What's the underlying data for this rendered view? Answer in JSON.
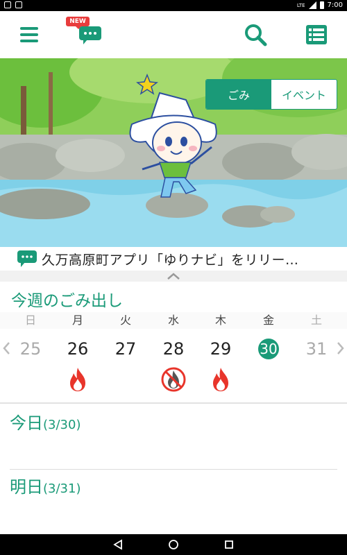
{
  "status_bar": {
    "time": "7:00",
    "network": "LTE"
  },
  "toolbar": {
    "new_badge": "NEW",
    "icons": [
      "menu-icon",
      "chat-bubble-icon",
      "search-icon",
      "list-icon"
    ]
  },
  "segment": {
    "garbage": "ごみ",
    "event": "イベント",
    "active": "garbage"
  },
  "news": {
    "text": "久万高原町アプリ「ゆりナビ」をリリー…"
  },
  "week": {
    "title": "今週のごみ出し",
    "days": [
      {
        "dow": "日",
        "num": "25",
        "muted": true,
        "garbage": ""
      },
      {
        "dow": "月",
        "num": "26",
        "muted": false,
        "garbage": "burnable"
      },
      {
        "dow": "火",
        "num": "27",
        "muted": false,
        "garbage": ""
      },
      {
        "dow": "水",
        "num": "28",
        "muted": false,
        "garbage": "non-burnable"
      },
      {
        "dow": "木",
        "num": "29",
        "muted": false,
        "garbage": "burnable"
      },
      {
        "dow": "金",
        "num": "30",
        "muted": false,
        "garbage": "",
        "today": true
      },
      {
        "dow": "土",
        "num": "31",
        "muted": true,
        "garbage": ""
      }
    ]
  },
  "today": {
    "label": "今日",
    "date": "(3/30)"
  },
  "tomorrow": {
    "label": "明日",
    "date": "(3/31)"
  },
  "colors": {
    "accent": "#1a9a78",
    "flame": "#e8352b"
  }
}
